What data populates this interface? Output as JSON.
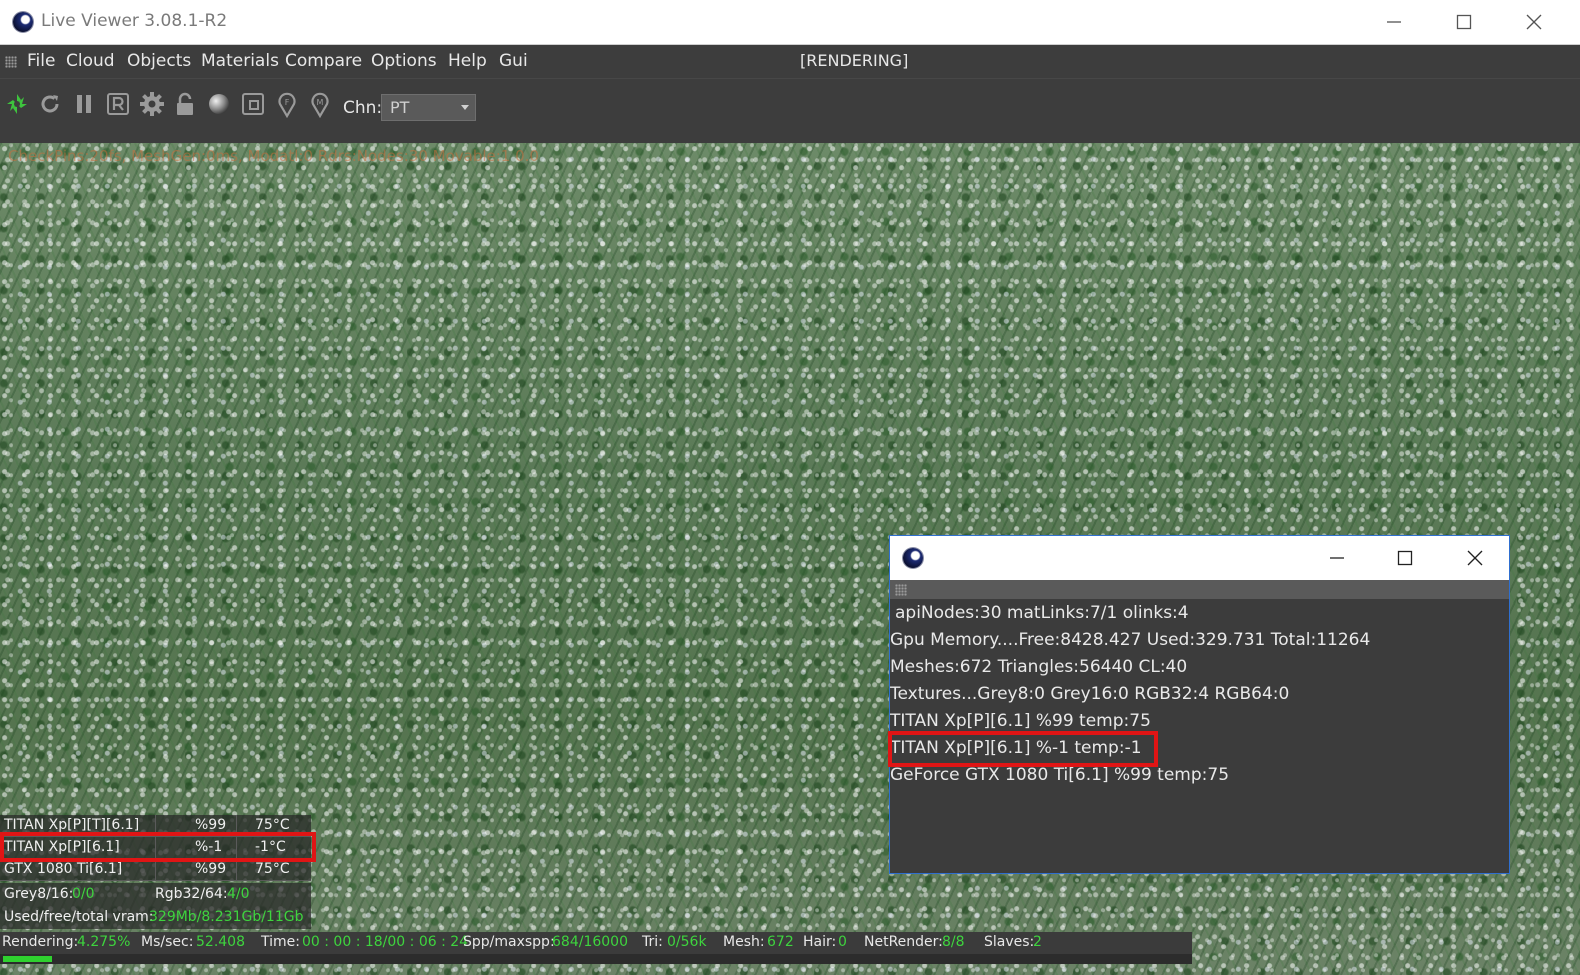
{
  "window": {
    "title": "Live Viewer 3.08.1-R2",
    "icon": "octane-render-icon",
    "controls": [
      "minimize-icon",
      "maximize-icon",
      "close-icon"
    ]
  },
  "menu": {
    "items": [
      "File",
      "Cloud",
      "Objects",
      "Materials",
      "Compare",
      "Options",
      "Help",
      "Gui"
    ],
    "status": "[RENDERING]"
  },
  "toolbar": {
    "buttons": [
      "render-icon",
      "restart-icon",
      "pause-icon",
      "region-render-icon",
      "settings-icon",
      "lock-icon",
      "material-ball-icon",
      "picker-icon",
      "focus-picker-icon",
      "material-picker-icon"
    ],
    "channel_label": "Chn:",
    "channel_value": "PT"
  },
  "viewport": {
    "overlay_text": "CheckPins:20fs, MeshGen:0ms, Modatl:0 Rdrs:Nodes:30 Movable:1 0.0"
  },
  "gpu_stats": {
    "rows": [
      {
        "name": "TITAN Xp[P][T][6.1]",
        "usage": "%99",
        "temp": "75°C"
      },
      {
        "name": "TITAN Xp[P][6.1]",
        "usage": "%-1",
        "temp": "-1°C"
      },
      {
        "name": "GTX 1080 Ti[6.1]",
        "usage": "%99",
        "temp": "75°C"
      }
    ],
    "grey_label": "Grey8/16:",
    "grey_value": "0/0",
    "rgb_label": "Rgb32/64:",
    "rgb_value": "4/0",
    "vram_label": "Used/free/total vram:",
    "vram_value": "329Mb/8.231Gb/11Gb",
    "highlight_color": "#e01515"
  },
  "status_bar": {
    "rendering_label": "Rendering:",
    "rendering_value": "4.275%",
    "ms_label": "Ms/sec:",
    "ms_value": "52.408",
    "time_label": "Time:",
    "time_value": "00 : 00 : 18/00 : 06 : 24",
    "spp_label": "Spp/maxspp:",
    "spp_value": "684/16000",
    "tri_label": "Tri:",
    "tri_value": "0/56k",
    "mesh_label": "Mesh:",
    "mesh_value": "672",
    "hair_label": "Hair:",
    "hair_value": "0",
    "netrender_label": "NetRender:",
    "netrender_value": "8/8",
    "slaves_label": "Slaves:",
    "slaves_value": "2",
    "progress_fraction": 0.04275,
    "accent_color": "#2fd12f"
  },
  "info_window": {
    "lines": [
      "apiNodes:30  matLinks:7/1 olinks:4",
      "Gpu Memory....Free:8428.427 Used:329.731 Total:11264",
      "Meshes:672 Triangles:56440 CL:40",
      "Textures...Grey8:0  Grey16:0  RGB32:4  RGB64:0",
      "TITAN Xp[P][6.1] %99 temp:75",
      "TITAN Xp[P][6.1] %-1 temp:-1",
      "GeForce GTX 1080 Ti[6.1] %99 temp:75"
    ],
    "highlighted_line": 5
  }
}
